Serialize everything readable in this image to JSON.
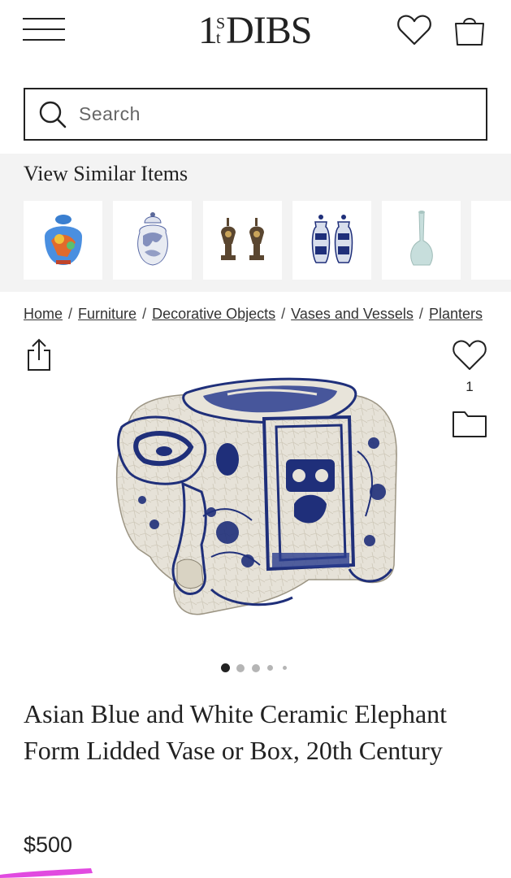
{
  "header": {
    "logo_main": "1",
    "logo_s": "S",
    "logo_t": "t",
    "logo_dibs": "DIBS"
  },
  "search": {
    "placeholder": "Search"
  },
  "similar": {
    "title": "View Similar Items",
    "items": [
      {
        "icon": "painted-ginger-jar-thumbnail"
      },
      {
        "icon": "blue-white-lidded-jar-thumbnail"
      },
      {
        "icon": "pair-of-bronze-urns-thumbnail"
      },
      {
        "icon": "pair-of-blue-white-vases-thumbnail"
      },
      {
        "icon": "celadon-bottle-vase-thumbnail"
      },
      {
        "icon": "blue-vase-thumbnail"
      }
    ]
  },
  "breadcrumb": {
    "items": [
      "Home",
      "Furniture",
      "Decorative Objects",
      "Vases and Vessels",
      "Planters"
    ]
  },
  "product": {
    "favorites_count": "1",
    "image_count": 5,
    "active_image": 1,
    "title": "Asian Blue and White Ceramic Elephant Form Lidded Vase or Box, 20th Century",
    "price": "$500"
  },
  "colors": {
    "text": "#222222",
    "panel": "#f3f3f3",
    "porcelain_blue": "#1f2f7a",
    "highlight": "#e14ae0"
  }
}
